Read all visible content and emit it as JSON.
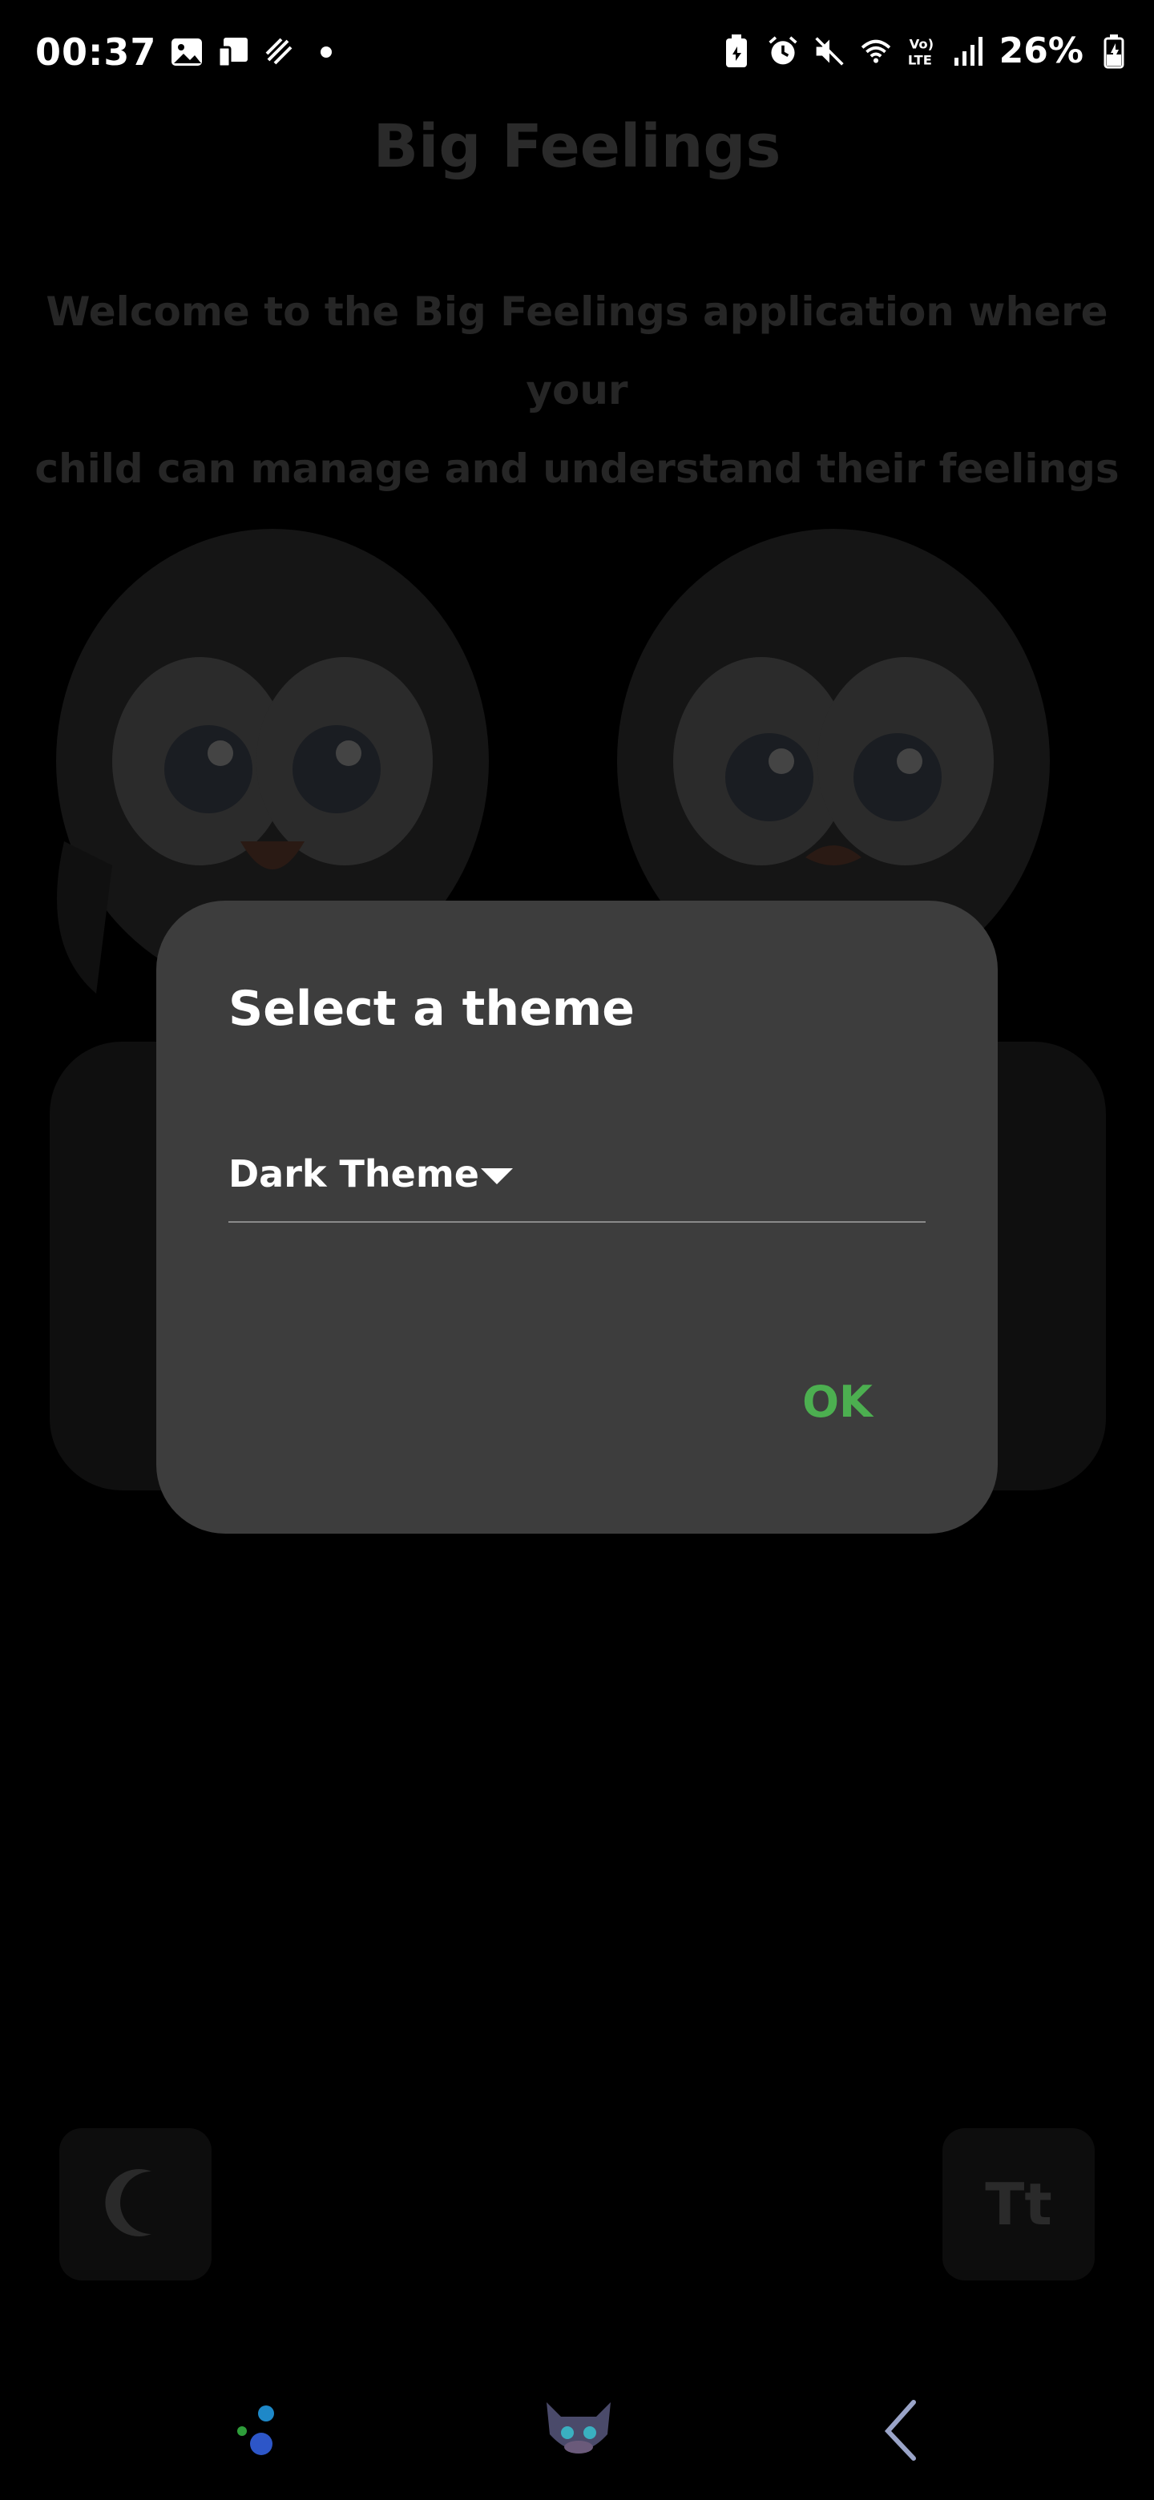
{
  "status_bar": {
    "time": "00:37",
    "battery": "26%",
    "icons_left": [
      "gallery-icon",
      "cast-icon",
      "link-icon",
      "dot-icon"
    ],
    "icons_right": [
      "battery-saver-icon",
      "alarm-icon",
      "mute-icon",
      "wifi-icon",
      "volte-icon",
      "signal-icon"
    ]
  },
  "app": {
    "title": "Big Feelings",
    "welcome_line1": "Welcome to the Big Feelings application where your",
    "welcome_line2": "child can manage and understand their feelings",
    "font_button_label": "Tt"
  },
  "dialog": {
    "title": "Select a theme",
    "selected_theme": "Dark Theme",
    "ok_label": "OK"
  },
  "colors": {
    "dialog_bg": "#3d3d3d",
    "accent": "#4caf50",
    "background": "#000000"
  }
}
